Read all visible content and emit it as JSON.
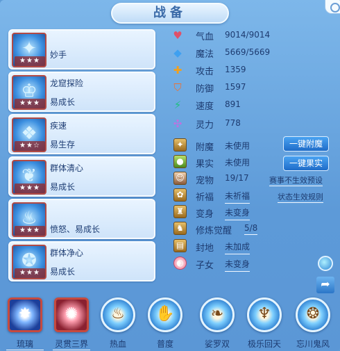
{
  "window": {
    "title": "战备"
  },
  "skills": [
    {
      "name": "妙手",
      "desc": "",
      "stars": "★★★",
      "icon": "bird-icon"
    },
    {
      "name": "龙窟探险",
      "desc": "易成长",
      "stars": "★★★",
      "icon": "helmet-icon"
    },
    {
      "name": "疾速",
      "desc": "易生存",
      "stars": "★★☆",
      "icon": "beast-icon"
    },
    {
      "name": "群体清心",
      "desc": "易成长",
      "stars": "★★★",
      "icon": "dragon-icon"
    },
    {
      "name": "",
      "desc": "愤怒、易成长",
      "stars": "★★★",
      "icon": "flame-icon"
    },
    {
      "name": "群体净心",
      "desc": "易成长",
      "stars": "★★★",
      "icon": "guardian-icon"
    }
  ],
  "stats": [
    {
      "label": "气血",
      "value": "9014/9014",
      "icon": "heart-icon",
      "color": "#e0506a"
    },
    {
      "label": "魔法",
      "value": "5669/5669",
      "icon": "diamond-icon",
      "color": "#3fa0f0"
    },
    {
      "label": "攻击",
      "value": "1359",
      "icon": "sword-icon",
      "color": "#f0a020"
    },
    {
      "label": "防御",
      "value": "1597",
      "icon": "shield-icon",
      "color": "#f07030"
    },
    {
      "label": "速度",
      "value": "891",
      "icon": "lightning-icon",
      "color": "#20c080"
    },
    {
      "label": "灵力",
      "value": "778",
      "icon": "sparkle-icon",
      "color": "#c070e0"
    }
  ],
  "extras": [
    {
      "label": "附魔",
      "value": "未使用",
      "icon": "enchant-icon"
    },
    {
      "label": "果实",
      "value": "未使用",
      "icon": "fruit-icon"
    },
    {
      "label": "宠物",
      "value": "19/17",
      "icon": "pet-icon"
    },
    {
      "label": "祈福",
      "value": "未祈福",
      "icon": "pray-icon"
    },
    {
      "label": "变身",
      "value": "未变身",
      "icon": "transform-icon"
    },
    {
      "label": "修炼觉醒",
      "value": "5/8",
      "icon": "cultivate-icon"
    },
    {
      "label": "封地",
      "value": "未加成",
      "icon": "fief-icon"
    },
    {
      "label": "子女",
      "value": "未变身",
      "icon": "child-icon"
    }
  ],
  "actions": {
    "enchant_button": "一键附魔",
    "fruit_button": "一键果实",
    "preset_link": "赛事不生效预设",
    "rules_link": "状态生效规则"
  },
  "formations": [
    {
      "name": "琉璃",
      "active": true
    },
    {
      "name": "灵贯三界",
      "active": true
    },
    {
      "name": "热血",
      "active": false
    },
    {
      "name": "普度",
      "active": false
    },
    {
      "name": "娑罗双",
      "active": false
    },
    {
      "name": "极乐回天",
      "active": false
    },
    {
      "name": "忘川鬼风",
      "active": false
    }
  ]
}
